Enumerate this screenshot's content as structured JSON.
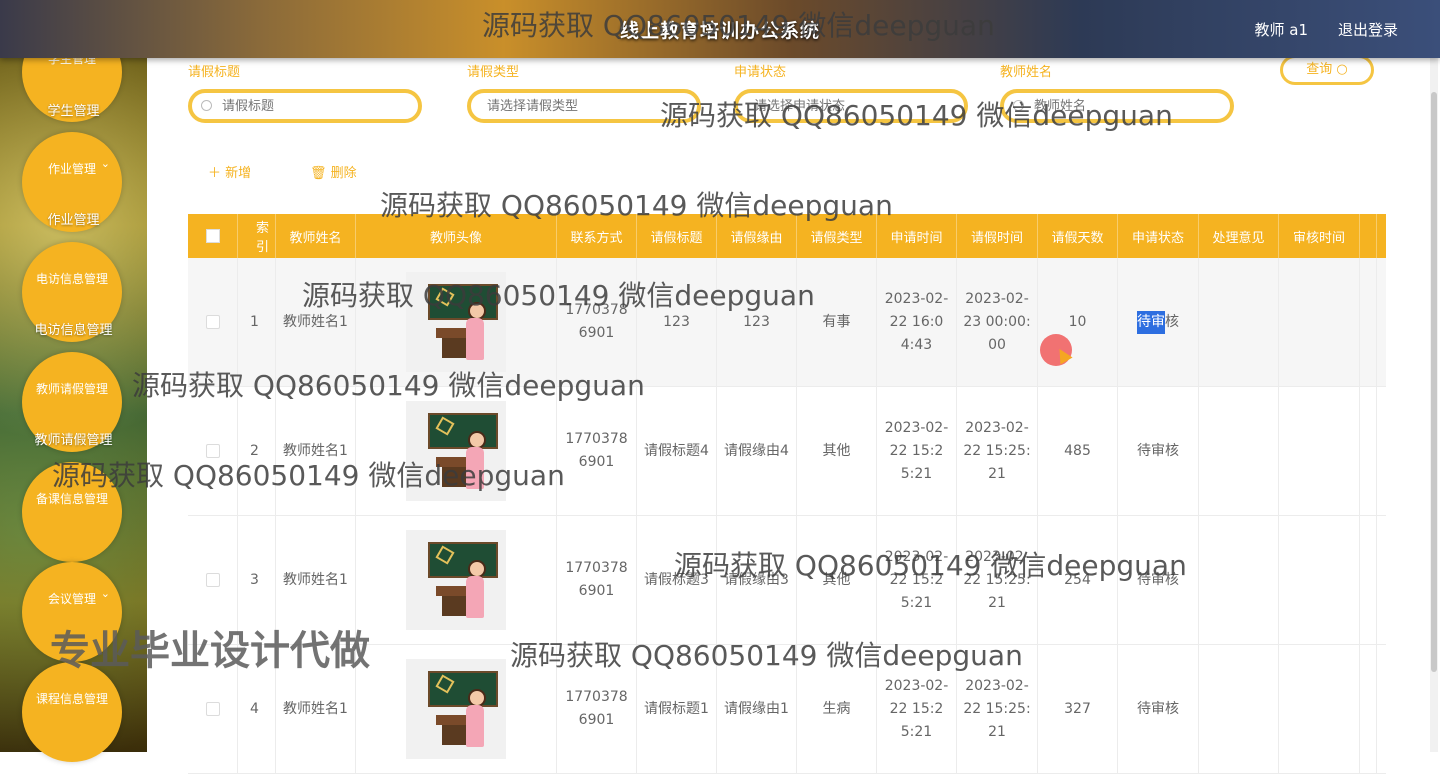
{
  "header": {
    "title": "线上教育培训办公系统",
    "user": "教师 a1",
    "logout": "退出登录"
  },
  "sidebar": [
    {
      "group": "学生管理",
      "sub": "学生管理"
    },
    {
      "group": "作业管理",
      "sub": "作业管理"
    },
    {
      "group": "电访信息管理",
      "sub": "电访信息管理"
    },
    {
      "group": "教师请假管理",
      "sub": "教师请假管理"
    },
    {
      "group": "备课信息管理",
      "sub": ""
    },
    {
      "group": "会议管理",
      "sub": ""
    },
    {
      "group": "课程信息管理",
      "sub": ""
    }
  ],
  "search": {
    "title_label": "请假标题",
    "title_placeholder": "请假标题",
    "type_label": "请假类型",
    "type_placeholder": "请选择请假类型",
    "status_label": "申请状态",
    "status_placeholder": "请选择申请状态",
    "teacher_label": "教师姓名",
    "teacher_placeholder": "教师姓名",
    "query_button": "查询"
  },
  "actions": {
    "add": "新增",
    "delete": "删除"
  },
  "table": {
    "headers": [
      "索引",
      "教师姓名",
      "教师头像",
      "联系方式",
      "请假标题",
      "请假缘由",
      "请假类型",
      "申请时间",
      "请假时间",
      "请假天数",
      "申请状态",
      "处理意见",
      "审核时间"
    ],
    "rows": [
      {
        "idx": "1",
        "name": "教师姓名1",
        "phone": "17703786901",
        "title": "123",
        "reason": "123",
        "type": "有事",
        "apply": "2023-02-22 16:04:43",
        "leave": "2023-02-23 00:00:00",
        "days": "10",
        "status_hl": "待审",
        "status_rest": "核"
      },
      {
        "idx": "2",
        "name": "教师姓名1",
        "phone": "17703786901",
        "title": "请假标题4",
        "reason": "请假缘由4",
        "type": "其他",
        "apply": "2023-02-22 15:25:21",
        "leave": "2023-02-22 15:25:21",
        "days": "485",
        "status_hl": "",
        "status_rest": "待审核"
      },
      {
        "idx": "3",
        "name": "教师姓名1",
        "phone": "17703786901",
        "title": "请假标题3",
        "reason": "请假缘由3",
        "type": "其他",
        "apply": "2023-02-22 15:25:21",
        "leave": "2023-02-22 15:25:21",
        "days": "254",
        "status_hl": "",
        "status_rest": "待审核"
      },
      {
        "idx": "4",
        "name": "教师姓名1",
        "phone": "17703786901",
        "title": "请假标题1",
        "reason": "请假缘由1",
        "type": "生病",
        "apply": "2023-02-22 15:25:21",
        "leave": "2023-02-22 15:25:21",
        "days": "327",
        "status_hl": "",
        "status_rest": "待审核"
      }
    ]
  },
  "watermark": {
    "text": "源码获取 QQ86050149 微信deepguan",
    "big": "专业毕业设计代做"
  },
  "colors": {
    "accent": "#f5b321"
  }
}
